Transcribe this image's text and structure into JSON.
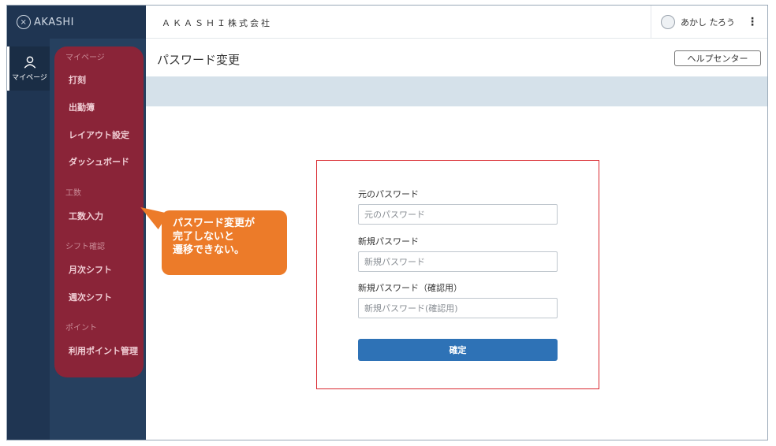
{
  "brand": {
    "name": "AKASHI"
  },
  "rail": {
    "item_label": "マイページ"
  },
  "subnav": {
    "sections": [
      {
        "heading": "マイページ",
        "items": [
          "打刻",
          "出勤簿",
          "レイアウト設定",
          "ダッシュボード"
        ]
      },
      {
        "heading": "工数",
        "items": [
          "工数入力"
        ]
      },
      {
        "heading": "シフト確認",
        "items": [
          "月次シフト",
          "週次シフト"
        ]
      },
      {
        "heading": "ポイント",
        "items": [
          "利用ポイント管理"
        ]
      }
    ]
  },
  "header": {
    "company": "ＡＫＡＳＨＩ株式会社",
    "user_name": "あかし たろう",
    "more_icon": "more-vertical-icon"
  },
  "page": {
    "title": "パスワード変更",
    "help_label": "ヘルプセンター"
  },
  "form": {
    "old_label": "元のパスワード",
    "old_placeholder": "元のパスワード",
    "new_label": "新規パスワード",
    "new_placeholder": "新規パスワード",
    "confirm_label": "新規パスワード（確認用）",
    "confirm_placeholder": "新規パスワード(確認用)",
    "submit_label": "確定"
  },
  "callout": {
    "lines": [
      "パスワード変更が",
      "完了しないと",
      "遷移できない。"
    ]
  },
  "colors": {
    "accent": "#2e72b6",
    "highlight": "#8a2438",
    "callout": "#ec7b29",
    "frame_red": "#d9282f"
  }
}
